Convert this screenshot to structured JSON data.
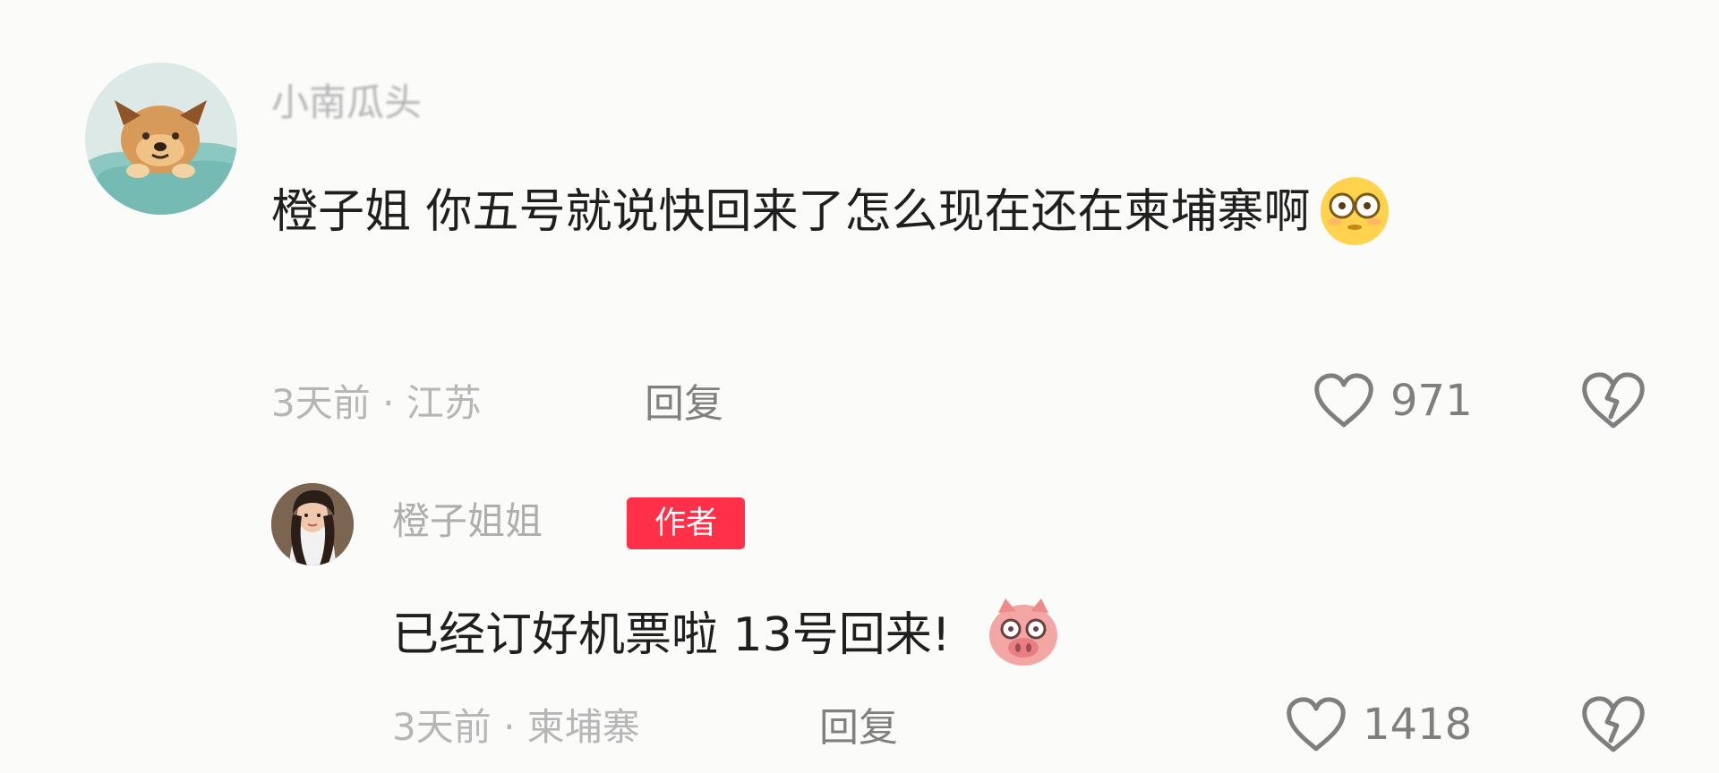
{
  "comment": {
    "username": "小南瓜头",
    "text": "橙子姐 你五号就说快回来了怎么现在还在柬埔寨啊",
    "meta": "3天前 · 江苏",
    "reply_label": "回复",
    "likes": "971"
  },
  "reply": {
    "username": "橙子姐姐",
    "badge": "作者",
    "text": "已经订好机票啦 13号回来!",
    "meta": "3天前 · 柬埔寨",
    "reply_label": "回复",
    "likes": "1418"
  },
  "icons": {
    "like": "heart-outline-icon",
    "dislike": "broken-heart-icon",
    "emoji_1": "flushed-face-emoji",
    "emoji_2": "pig-face-emoji"
  },
  "colors": {
    "background": "#fbfbfa",
    "text_primary": "#1f1f1f",
    "text_secondary": "#b6b6b6",
    "action_gray": "#808080",
    "author_badge": "#ff3048"
  }
}
